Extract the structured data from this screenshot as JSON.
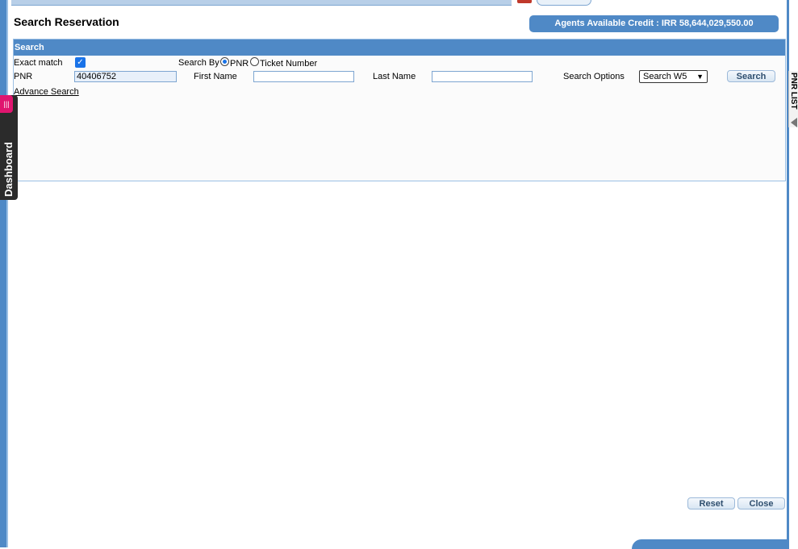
{
  "page": {
    "title": "Search Reservation"
  },
  "credit": {
    "text": "Agents Available Credit : IRR 58,644,029,550.00"
  },
  "search": {
    "header": "Search",
    "exact_match_label": "Exact match",
    "exact_match_checked": true,
    "search_by_label": "Search By",
    "search_by_options": [
      "PNR",
      "Ticket Number"
    ],
    "search_by_selected": "PNR",
    "pnr_label": "PNR",
    "pnr_value": "40406752",
    "first_name_label": "First Name",
    "first_name_value": "",
    "last_name_label": "Last Name",
    "last_name_value": "",
    "search_options_label": "Search Options",
    "search_options_selected": "Search W5",
    "search_button": "Search",
    "advance_search": "Advance Search"
  },
  "footer": {
    "reset_button": "Reset",
    "close_button": "Close"
  },
  "dashboard": {
    "label": "Dashboard"
  },
  "pnr_list": {
    "label": "PNR LIST"
  },
  "colors": {
    "accent": "#4f89c6",
    "dashboard_pin": "#e0156f"
  }
}
